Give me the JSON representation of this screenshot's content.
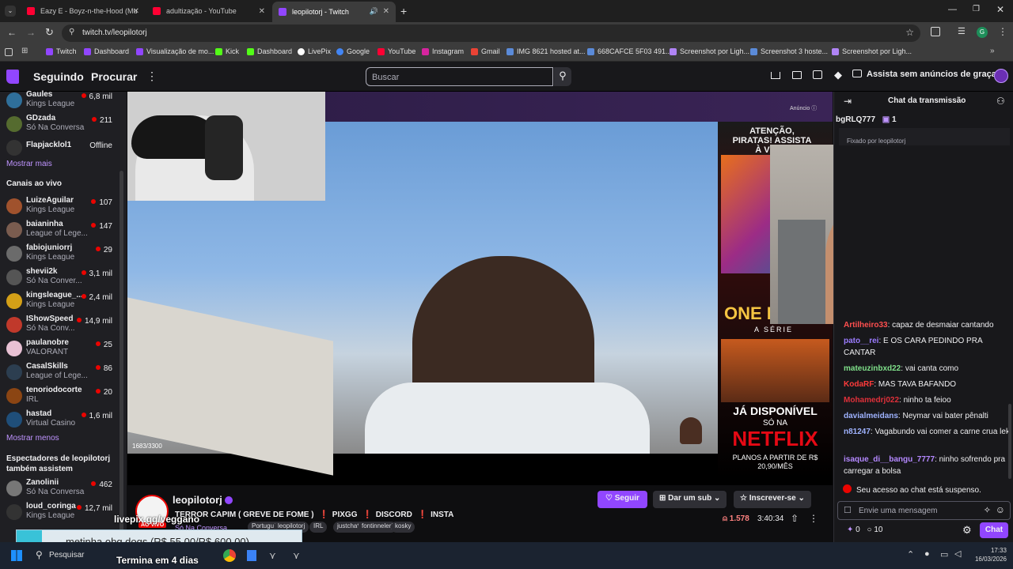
{
  "browser": {
    "tabs": [
      {
        "title": "Eazy E - Boyz-n-the-Hood (Mu",
        "favicon_color": "#ff0033"
      },
      {
        "title": "adultização - YouTube",
        "favicon_color": "#ff0033"
      },
      {
        "title": "leopilotorj - Twitch",
        "favicon_color": "#9146ff"
      }
    ],
    "url": "twitch.tv/leopilotorj",
    "bookmarks": [
      "Twitch",
      "Dashboard",
      "Visualização de mo...",
      "Kick",
      "Dashboard",
      "LivePix",
      "Google",
      "YouTube",
      "Instagram",
      "Gmail",
      "IMG 8621 hosted at...",
      "668CAFCE 5F03 491...",
      "Screenshot por Ligh...",
      "Screenshot 3 hoste...",
      "Screenshot por Ligh..."
    ]
  },
  "twitch": {
    "nav": {
      "following": "Seguindo",
      "browse": "Procurar",
      "search_placeholder": "Buscar",
      "ad_free": "Assista sem anúncios de graça"
    },
    "sidebar": {
      "followed": [
        {
          "name": "Gaules",
          "game": "Kings League",
          "viewers": "6,8 mil",
          "color": "#2f6f9a"
        },
        {
          "name": "GDzada",
          "game": "Só Na Conversa",
          "viewers": "211",
          "color": "#556b2f"
        },
        {
          "name": "Flapjacklol1",
          "game": "",
          "viewers": "Offline",
          "color": "#333"
        }
      ],
      "show_more": "Mostrar mais",
      "live_title": "Canais ao vivo",
      "live": [
        {
          "name": "LuizeAguilar",
          "game": "Kings League",
          "viewers": "107",
          "color": "#a0522d"
        },
        {
          "name": "baianinha",
          "game": "League of Lege...",
          "viewers": "147",
          "color": "#7a5c4f"
        },
        {
          "name": "fabiojuniorrj",
          "game": "Kings League",
          "viewers": "29",
          "color": "#6b6b6b"
        },
        {
          "name": "shevii2k",
          "game": "Só Na Conver...",
          "viewers": "3,1 mil",
          "color": "#555"
        },
        {
          "name": "kingsleague_...",
          "game": "Kings League",
          "viewers": "2,4 mil",
          "color": "#d4a017"
        },
        {
          "name": "IShowSpeed",
          "game": "Só Na Conv...",
          "viewers": "14,9 mil",
          "color": "#c0392b"
        },
        {
          "name": "paulanobre",
          "game": "VALORANT",
          "viewers": "25",
          "color": "#e8c1d4"
        },
        {
          "name": "CasalSkills",
          "game": "League of Lege...",
          "viewers": "86",
          "color": "#2c3e50"
        },
        {
          "name": "tenoriodocorte",
          "game": "IRL",
          "viewers": "20",
          "color": "#8b4513"
        },
        {
          "name": "hastad",
          "game": "Virtual Casino",
          "viewers": "1,6 mil",
          "color": "#1f4e79"
        }
      ],
      "show_less": "Mostrar menos",
      "viewers_title": "Espectadores de leopilotorj também assistem",
      "also_watch": [
        {
          "name": "Zanolinii",
          "game": "Só Na Conversa",
          "viewers": "462",
          "color": "#777"
        },
        {
          "name": "loud_coringa",
          "game": "Kings League",
          "viewers": "12,7 mil",
          "color": "#333"
        }
      ]
    },
    "player": {
      "ad_label": "Anúncio",
      "counter": "1683/3300",
      "ad_top": "ATENÇÃO, PIRATAS! ASSISTA À VISTA",
      "ad_series": "ONE PIECE",
      "ad_sub": "A SÉRIE",
      "ad_available": "JÁ DISPONÍVEL",
      "ad_only": "SÓ NA",
      "ad_brand": "NETFLIX",
      "ad_price": "PLANOS A PARTIR DE R$ 20,90/MÊS"
    },
    "stream": {
      "channel": "leopilotorj",
      "live_badge": "AO VIVO",
      "title_parts": [
        "TERROR CAPIM ( GREVE DE FOME )",
        "PIXGG",
        "DISCORD",
        "INSTA"
      ],
      "category": "Só Na Conversa",
      "tags": [
        "Português",
        "leopilotorj",
        "IRL",
        "justchatting",
        "fontinnelerj",
        "kosky"
      ],
      "follow": "Seguir",
      "gift_sub": "Dar um sub",
      "subscribe": "Inscrever-se",
      "viewers": "1.578",
      "uptime": "3:40:34",
      "overlay_url": "livepix.gg/veggano",
      "donation": "metinha obg dogs (R$ 55,00/R$ 600,00)",
      "ends": "Termina em 4 dias"
    },
    "chat": {
      "header": "Chat da transmissão",
      "top_user": "bgRLQ777",
      "top_gifts": "1",
      "pinned_by": "Fixado por",
      "pinned_user": "leopilotorj",
      "messages": [
        {
          "user": "Artilheiro33",
          "text": "capaz de desmaiar cantando",
          "color": "#ff4f4f"
        },
        {
          "user": "pato__rei",
          "text": "E OS CARA PEDINDO PRA CANTAR",
          "color": "#9b7cff"
        },
        {
          "user": "mateuzinbxd22",
          "text": "vai canta como",
          "color": "#7fe08a"
        },
        {
          "user": "KodaRF",
          "text": "MAS TAVA BAFANDO",
          "color": "#ff3b3b"
        },
        {
          "user": "Mohamedrj022",
          "text": "ninho ta feioo",
          "color": "#e0303a"
        },
        {
          "user": "davialmeidans",
          "text": "Neymar vai bater pênalti",
          "color": "#9fb3ff"
        },
        {
          "user": "n81247",
          "text": "Vagabundo vai comer a carne crua lek",
          "color": "#9fb3ff"
        },
        {
          "user": "isaque_di__bangu_7777",
          "text": "ninho sofrendo pra carregar a bolsa",
          "color": "#b488ff"
        }
      ],
      "suspended": "Seu acesso ao chat está suspenso.",
      "input_placeholder": "Envie uma mensagem",
      "points": "0",
      "bits": "10",
      "send": "Chat"
    }
  },
  "taskbar": {
    "search": "Pesquisar",
    "time": "17:33",
    "date": "16/03/2026"
  }
}
